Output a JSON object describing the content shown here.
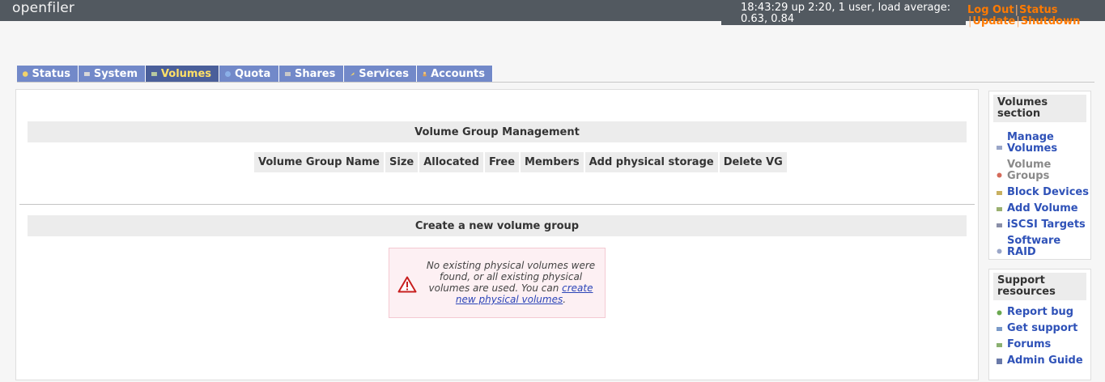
{
  "header": {
    "logo": "openfiler",
    "uptime": "18:43:29 up 2:20, 1 user, load average: 0.63, 0.84",
    "links": {
      "logout": "Log Out",
      "status": "Status",
      "update": "Update",
      "shutdown": "Shutdown"
    }
  },
  "tabs": [
    {
      "label": "Status"
    },
    {
      "label": "System"
    },
    {
      "label": "Volumes"
    },
    {
      "label": "Quota"
    },
    {
      "label": "Shares"
    },
    {
      "label": "Services"
    },
    {
      "label": "Accounts"
    }
  ],
  "main": {
    "vg_management_title": "Volume Group Management",
    "columns": [
      "Volume Group Name",
      "Size",
      "Allocated",
      "Free",
      "Members",
      "Add physical storage",
      "Delete VG"
    ],
    "create_title": "Create a new volume group",
    "warning": {
      "text": "No existing physical volumes were found, or all existing physical volumes are used. You can ",
      "link": "create new physical volumes",
      "suffix": "."
    }
  },
  "sidebar": {
    "volumes_section": {
      "title": "Volumes section",
      "items": [
        {
          "label": "Manage Volumes"
        },
        {
          "label": "Volume Groups"
        },
        {
          "label": "Block Devices"
        },
        {
          "label": "Add Volume"
        },
        {
          "label": "iSCSI Targets"
        },
        {
          "label": "Software RAID"
        }
      ]
    },
    "support": {
      "title": "Support resources",
      "items": [
        {
          "label": "Report bug"
        },
        {
          "label": "Get support"
        },
        {
          "label": "Forums"
        },
        {
          "label": "Admin Guide"
        }
      ]
    }
  },
  "colors": {
    "topbar": "#525960",
    "tab": "#7289c9",
    "tab_active": "#4a5f9a",
    "tab_active_text": "#ffe067",
    "link_orange": "#ff7a00",
    "link_blue": "#2f52b8"
  }
}
